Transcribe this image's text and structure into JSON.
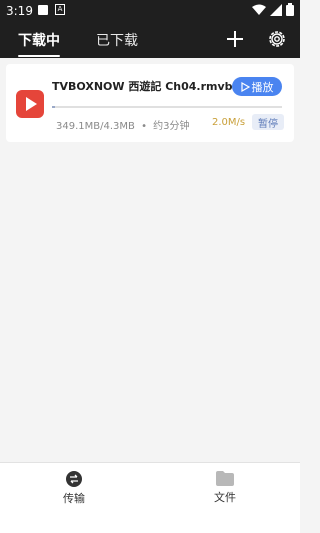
{
  "status_bar": {
    "time": "3:19",
    "icons": [
      "square-notification-icon",
      "a-notification-icon",
      "wifi-icon",
      "signal-icon",
      "battery-icon"
    ]
  },
  "header": {
    "tabs": [
      {
        "label": "下载中",
        "active": true
      },
      {
        "label": "已下载",
        "active": false
      }
    ],
    "icons": [
      "plus-icon",
      "gear-icon"
    ]
  },
  "download": {
    "file_name": "TVBOXNOW 西遊記 Ch04.rmvb",
    "play_label": "播放",
    "progress": 0.012,
    "size_text": "349.1MB/4.3MB",
    "separator": "•",
    "eta": "约3分钟",
    "speed": "2.0M/s",
    "pause_label": "暂停"
  },
  "bottom_nav": {
    "items": [
      {
        "label": "传输",
        "icon": "transfer-icon"
      },
      {
        "label": "文件",
        "icon": "folder-icon"
      }
    ]
  },
  "colors": {
    "header_bg": "#1f1f1f",
    "accent_blue": "#4a84f0",
    "app_icon_red": "#e5453a",
    "speed_gold": "#c9a03a"
  }
}
